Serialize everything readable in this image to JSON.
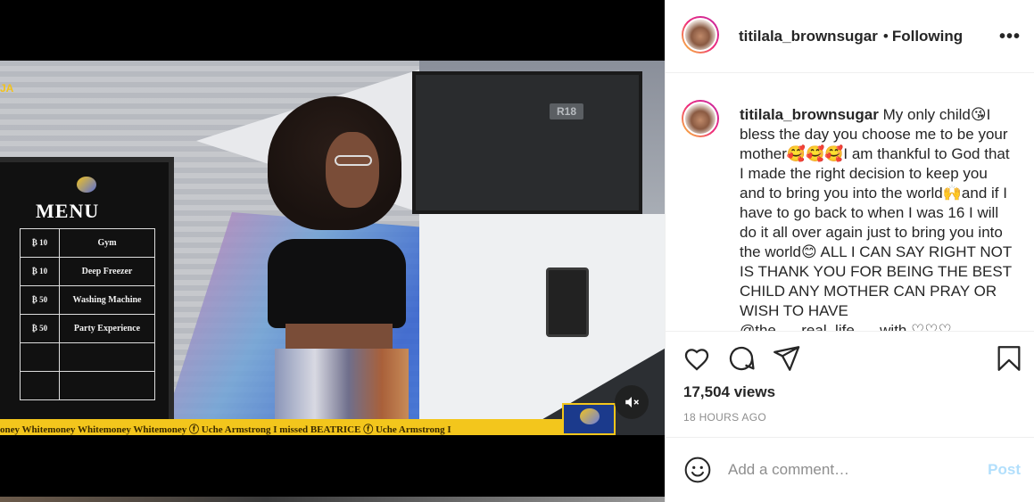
{
  "video": {
    "tv_label": "R18",
    "menu": {
      "title": "MENU",
      "items": [
        {
          "price": "₿ 10",
          "name": "Gym"
        },
        {
          "price": "₿ 10",
          "name": "Deep Freezer"
        },
        {
          "price": "₿ 50",
          "name": "Washing Machine"
        },
        {
          "price": "₿ 50",
          "name": "Party Experience"
        }
      ]
    },
    "ticker_text": "oney Whitemoney Whitemoney Whitemoney  ⓕ Uche Armstrong  I missed BEATRICE  ⓕ Uche Armstrong  I",
    "corner_logo": "JA",
    "mute_icon": "speaker-muted-icon"
  },
  "post": {
    "username": "titilala_brownsugar",
    "separator": "•",
    "follow_status": "Following",
    "more_icon": "•••",
    "caption": "My only child😘I bless the day you choose me to be your mother🥰🥰🥰I am thankful to God that I made the right decision to keep you and to bring you into the world🙌and if I have to go back to when I was 16 I will do it all over again just to bring you into the world😊 ALL I CAN SAY RIGHT NOT IS THANK YOU FOR BEING THE BEST CHILD ANY MOTHER CAN PRAY OR WISH TO HAVE @the___real_life___with ♡♡♡",
    "views": "17,504 views",
    "time_ago": "18 HOURS AGO",
    "actions": [
      "heart-icon",
      "comment-icon",
      "share-icon",
      "bookmark-icon"
    ]
  },
  "comment": {
    "placeholder": "Add a comment…",
    "post_label": "Post",
    "emoji_icon": "smiley-icon"
  },
  "colors": {
    "ticker": "#f3c61c",
    "post_button": "#b2dffc",
    "text": "#262626",
    "muted": "#8e8e8e"
  }
}
